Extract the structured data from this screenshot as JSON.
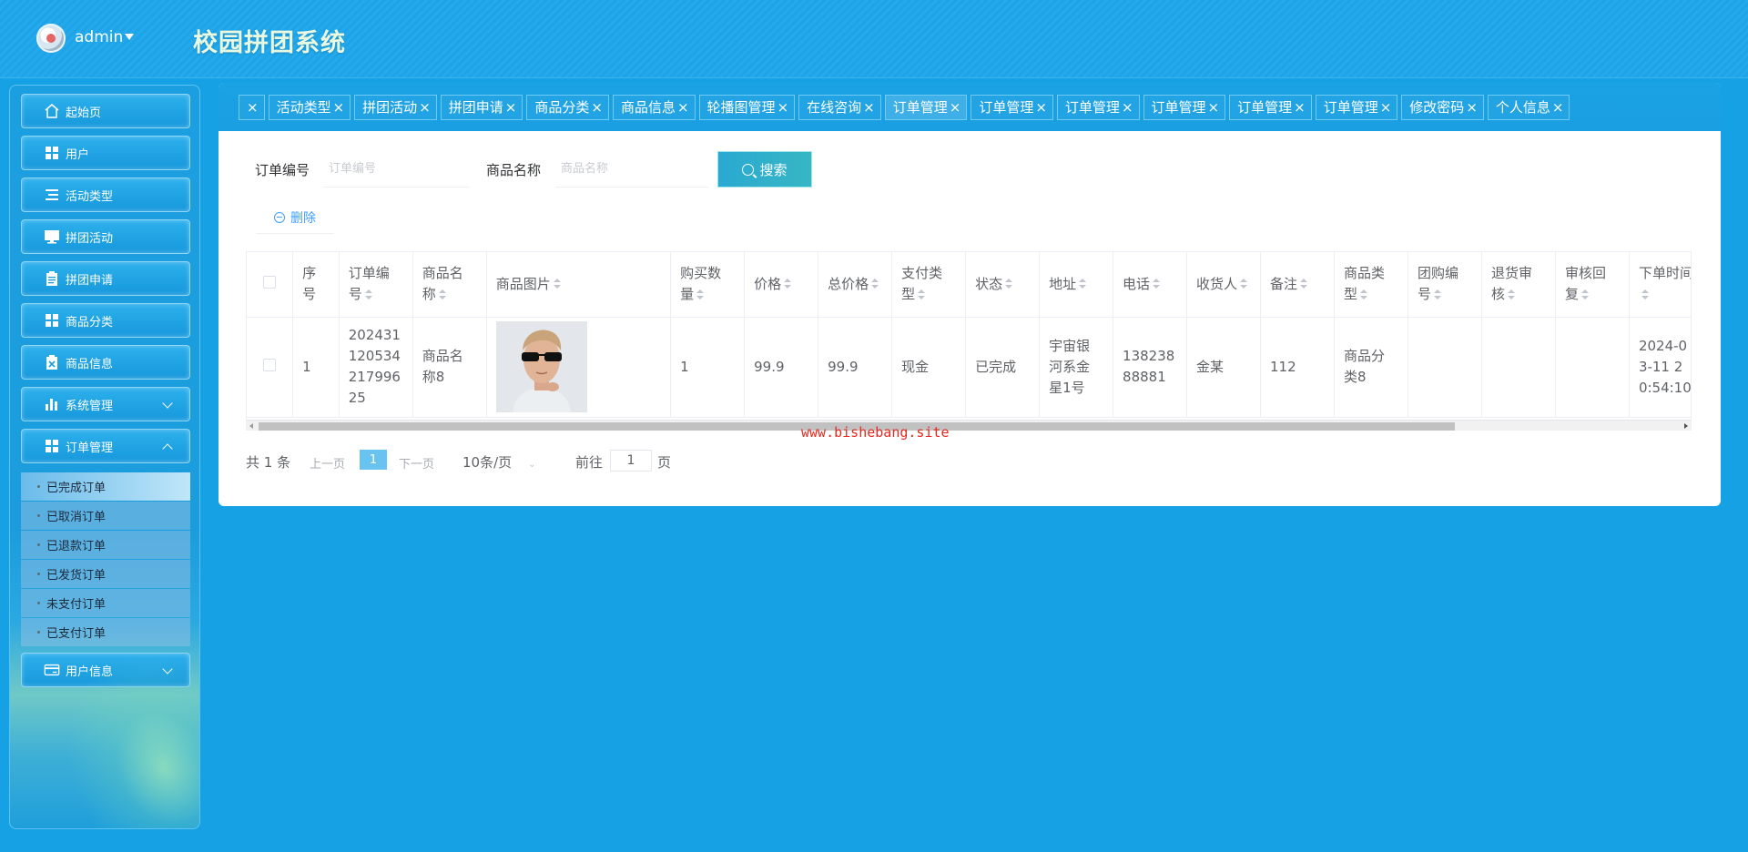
{
  "header": {
    "user": "admin",
    "title": "校园拼团系统"
  },
  "sidebar": {
    "items": [
      {
        "label": "起始页",
        "icon": "home-icon"
      },
      {
        "label": "用户",
        "icon": "grid-icon"
      },
      {
        "label": "活动类型",
        "icon": "list-icon"
      },
      {
        "label": "拼团活动",
        "icon": "monitor-icon"
      },
      {
        "label": "拼团申请",
        "icon": "clipboard-icon"
      },
      {
        "label": "商品分类",
        "icon": "grid-icon"
      },
      {
        "label": "商品信息",
        "icon": "clipboard-x-icon"
      },
      {
        "label": "系统管理",
        "icon": "bar-chart-icon"
      },
      {
        "label": "订单管理",
        "icon": "grid-icon"
      },
      {
        "label": "用户信息",
        "icon": "card-icon"
      }
    ],
    "submenu": [
      "已完成订单",
      "已取消订单",
      "已退款订单",
      "已发货订单",
      "未支付订单",
      "已支付订单"
    ]
  },
  "tabs": [
    "活动类型",
    "拼团活动",
    "拼团申请",
    "商品分类",
    "商品信息",
    "轮播图管理",
    "在线咨询",
    "订单管理",
    "订单管理",
    "订单管理",
    "订单管理",
    "订单管理",
    "订单管理",
    "修改密码",
    "个人信息"
  ],
  "search": {
    "order_no_label": "订单编号",
    "order_no_placeholder": "订单编号",
    "product_name_label": "商品名称",
    "product_name_placeholder": "商品名称",
    "search_button": "搜索",
    "delete_button": "删除"
  },
  "table": {
    "headers": [
      "序号",
      "订单编号",
      "商品名称",
      "商品图片",
      "购买数量",
      "价格",
      "总价格",
      "支付类型",
      "状态",
      "地址",
      "电话",
      "收货人",
      "备注",
      "商品类型",
      "团购编号",
      "退货审核",
      "审核回复",
      "下单时间"
    ],
    "rows": [
      {
        "index": "1",
        "order_no": "2024311205342179962 5",
        "order_no_display": "20243112053421799625",
        "product_name": "商品名称8",
        "quantity": "1",
        "price": "99.9",
        "total": "99.9",
        "pay_type": "现金",
        "status": "已完成",
        "address": "宇宙银河系金星1号",
        "phone": "13823888881",
        "receiver": "金某",
        "remark": "112",
        "product_type": "商品分类8",
        "group_no": "",
        "return_review": "",
        "review_reply": "",
        "order_time": "2024-03-11 20:54:10"
      }
    ]
  },
  "pagination": {
    "total": "共 1 条",
    "prev": "上一页",
    "current": "1",
    "next": "下一页",
    "page_size": "10条/页",
    "goto": "前往",
    "goto_value": "1",
    "page_unit": "页"
  },
  "watermark": "www.bishebang.site"
}
